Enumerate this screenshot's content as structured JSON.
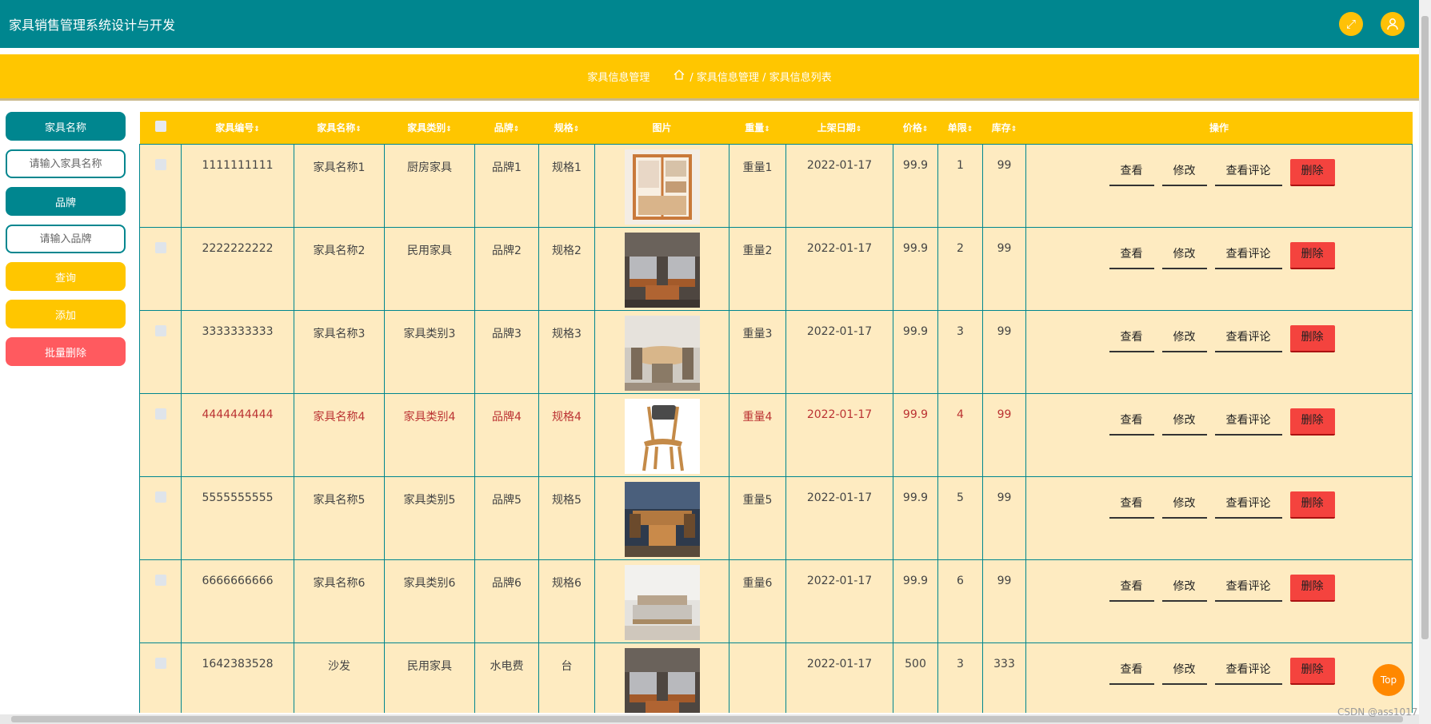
{
  "header": {
    "title": "家具销售管理系统设计与开发"
  },
  "breadcrumb": {
    "section": "家具信息管理",
    "path": "/ 家具信息管理 / 家具信息列表"
  },
  "sidebar": {
    "name_label": "家具名称",
    "name_placeholder": "请输入家具名称",
    "brand_label": "品牌",
    "brand_placeholder": "请输入品牌",
    "query_button": "查询",
    "add_button": "添加",
    "batch_delete_button": "批量删除"
  },
  "table": {
    "columns": [
      "家具编号",
      "家具名称",
      "家具类别",
      "品牌",
      "规格",
      "图片",
      "重量",
      "上架日期",
      "价格",
      "单限",
      "库存",
      "操作"
    ],
    "sortable": [
      true,
      true,
      true,
      true,
      true,
      false,
      true,
      true,
      true,
      true,
      true,
      false
    ],
    "rows": [
      {
        "id": "1111111111",
        "name": "家具名称1",
        "category": "厨房家具",
        "brand": "品牌1",
        "spec": "规格1",
        "image": "wardrobe",
        "weight": "重量1",
        "date": "2022-01-17",
        "price": "99.9",
        "limit": "1",
        "stock": "99"
      },
      {
        "id": "2222222222",
        "name": "家具名称2",
        "category": "民用家具",
        "brand": "品牌2",
        "spec": "规格2",
        "image": "sofa",
        "weight": "重量2",
        "date": "2022-01-17",
        "price": "99.9",
        "limit": "2",
        "stock": "99"
      },
      {
        "id": "3333333333",
        "name": "家具名称3",
        "category": "家具类别3",
        "brand": "品牌3",
        "spec": "规格3",
        "image": "dining",
        "weight": "重量3",
        "date": "2022-01-17",
        "price": "99.9",
        "limit": "3",
        "stock": "99"
      },
      {
        "id": "4444444444",
        "name": "家具名称4",
        "category": "家具类别4",
        "brand": "品牌4",
        "spec": "规格4",
        "image": "chair",
        "weight": "重量4",
        "date": "2022-01-17",
        "price": "99.9",
        "limit": "4",
        "stock": "99"
      },
      {
        "id": "5555555555",
        "name": "家具名称5",
        "category": "家具类别5",
        "brand": "品牌5",
        "spec": "规格5",
        "image": "diningroom",
        "weight": "重量5",
        "date": "2022-01-17",
        "price": "99.9",
        "limit": "5",
        "stock": "99"
      },
      {
        "id": "6666666666",
        "name": "家具名称6",
        "category": "家具类别6",
        "brand": "品牌6",
        "spec": "规格6",
        "image": "bed",
        "weight": "重量6",
        "date": "2022-01-17",
        "price": "99.9",
        "limit": "6",
        "stock": "99"
      },
      {
        "id": "1642383528",
        "name": "沙发",
        "category": "民用家具",
        "brand": "水电费",
        "spec": "台",
        "image": "sofa",
        "weight": "",
        "date": "2022-01-17",
        "price": "500",
        "limit": "3",
        "stock": "333"
      }
    ],
    "actions": {
      "view": "查看",
      "edit": "修改",
      "comments": "查看评论",
      "delete": "删除"
    }
  },
  "top_button": "Top",
  "watermark": "CSDN @ass1017",
  "colors": {
    "primary": "#00868f",
    "accent": "#ffc600",
    "danger": "#f4433e",
    "row_bg": "#feebc1"
  }
}
